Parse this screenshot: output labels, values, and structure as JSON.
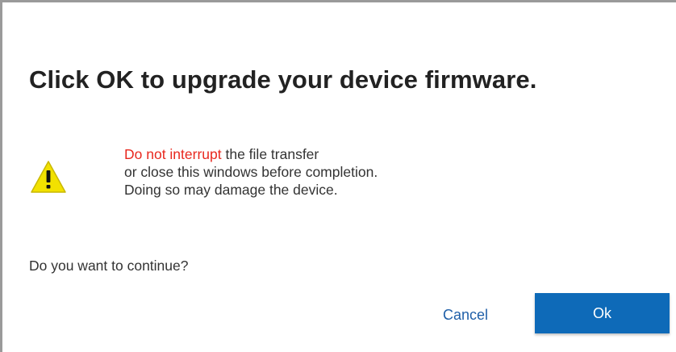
{
  "dialog": {
    "title": "Click OK to upgrade your device firmware.",
    "warning": {
      "icon": "warning-triangle-icon",
      "highlight": "Do not interrupt",
      "line1_rest": " the file transfer",
      "line2": "or close this windows before completion.",
      "line3": "Doing so may damage the device."
    },
    "question": "Do you want to continue?",
    "buttons": {
      "cancel_label": "Cancel",
      "ok_label": "Ok"
    }
  },
  "colors": {
    "accent": "#0e6ab8",
    "warning_text": "#e8281e",
    "warning_icon_fill": "#f2e100",
    "link_text": "#1f5fa8"
  }
}
